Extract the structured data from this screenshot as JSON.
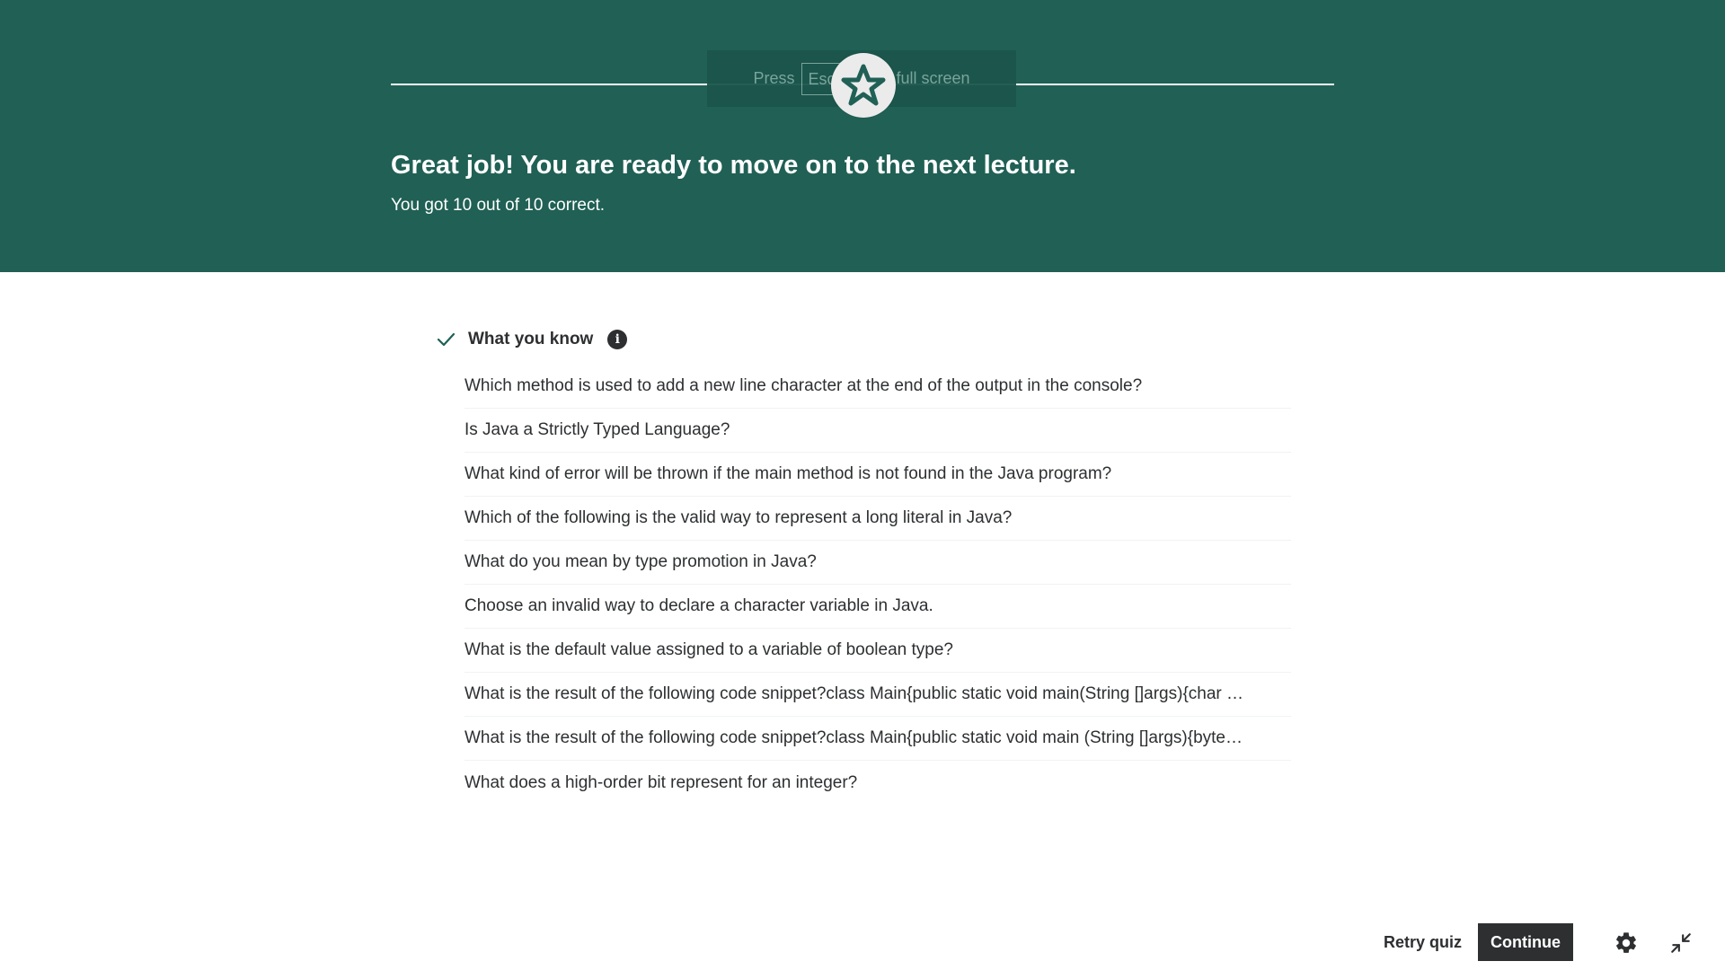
{
  "banner": {
    "fullscreen_hint": {
      "prefix": "Press",
      "key": "Esc",
      "suffix": "to exit full screen"
    },
    "badge_icon": "star-icon",
    "title": "Great job! You are ready to move on to the next lecture.",
    "subtitle": "You got 10 out of 10 correct.",
    "color": "#206055"
  },
  "results": {
    "section_title": "What you know",
    "check_icon": "checkmark-icon",
    "info_icon": "info-icon",
    "questions": [
      "Which method is used to add a new line character at the end of the output in the console?",
      "Is Java a Strictly Typed Language?",
      "What kind of error will be thrown if the main method is not found in the Java program?",
      "Which of the following is the valid way to represent a long literal in Java?",
      "What do you mean by type promotion in Java?",
      "Choose an invalid way to declare a character variable in Java.",
      "What is the default value assigned to a variable of boolean type?",
      "What is the result of the following code snippet?class Main{public static void main(String []args){char …",
      "What is the result of the following code snippet?class Main{public static void main (String []args){byte…",
      "What does a high-order bit represent for an integer?"
    ]
  },
  "footer": {
    "retry_label": "Retry quiz",
    "continue_label": "Continue",
    "settings_icon": "gear-icon",
    "exit_fullscreen_icon": "exit-fullscreen-icon"
  },
  "colors": {
    "accent": "#206055",
    "check": "#1e6055",
    "dark": "#2d2f31"
  }
}
